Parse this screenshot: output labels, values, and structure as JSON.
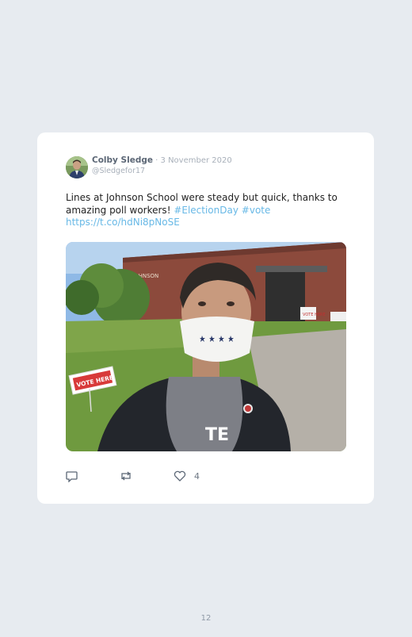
{
  "tweet": {
    "author_name": "Colby Sledge",
    "separator": " · ",
    "date": "3 November 2020",
    "handle": "@Sledgefor17",
    "text_main": "Lines at Johnson School were steady but quick, thanks to amazing poll workers! ",
    "hashtag1": "#ElectionDay",
    "hashtag2": "#vote",
    "url": "https://t.co/hdNi8pNoSE",
    "photo_sign_text": "VOTE HERE",
    "photo_building_text": "JOHNSON",
    "photo_door_sign": "VOTE HERE",
    "like_count": "4"
  },
  "icons": {
    "reply": "reply-icon",
    "retweet": "retweet-icon",
    "like": "heart-icon"
  },
  "colors": {
    "background": "#e7ebf0",
    "card": "#ffffff",
    "link": "#67b8e6",
    "name": "#5b6675",
    "muted": "#a8b0ba"
  },
  "page": {
    "number": "12"
  }
}
